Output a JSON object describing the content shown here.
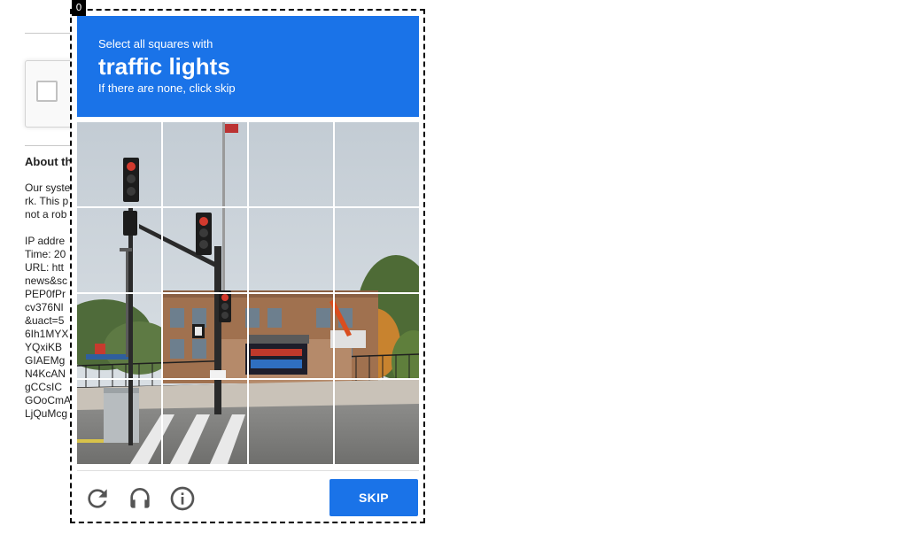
{
  "background_page": {
    "about_title": "About th",
    "lines": [
      "Our syste",
      "rk. This p",
      "not a rob",
      "IP addre",
      "Time: 20",
      "URL: htt",
      "news&sc",
      "PEP0fPr",
      "cv376Nl",
      "&uact=5",
      "6Ih1MYX",
      "YQxiKB",
      "GIAEMg",
      "N4KcAN",
      "gCCsIC",
      "GOoCmA",
      "LjQuMcg"
    ]
  },
  "frame_index": "0",
  "challenge": {
    "instruction": "Select all squares with",
    "keyword": "traffic lights",
    "hint": "If there are none, click skip"
  },
  "grid": {
    "rows": 4,
    "cols": 4,
    "scene": "street intersection with traffic lights, school sign, brick building and crosswalk"
  },
  "footer": {
    "reload_icon": "reload-icon",
    "audio_icon": "headphones-icon",
    "info_icon": "info-icon",
    "skip_label": "SKIP"
  },
  "colors": {
    "accent": "#1a73e8",
    "frame_border": "#000000"
  }
}
